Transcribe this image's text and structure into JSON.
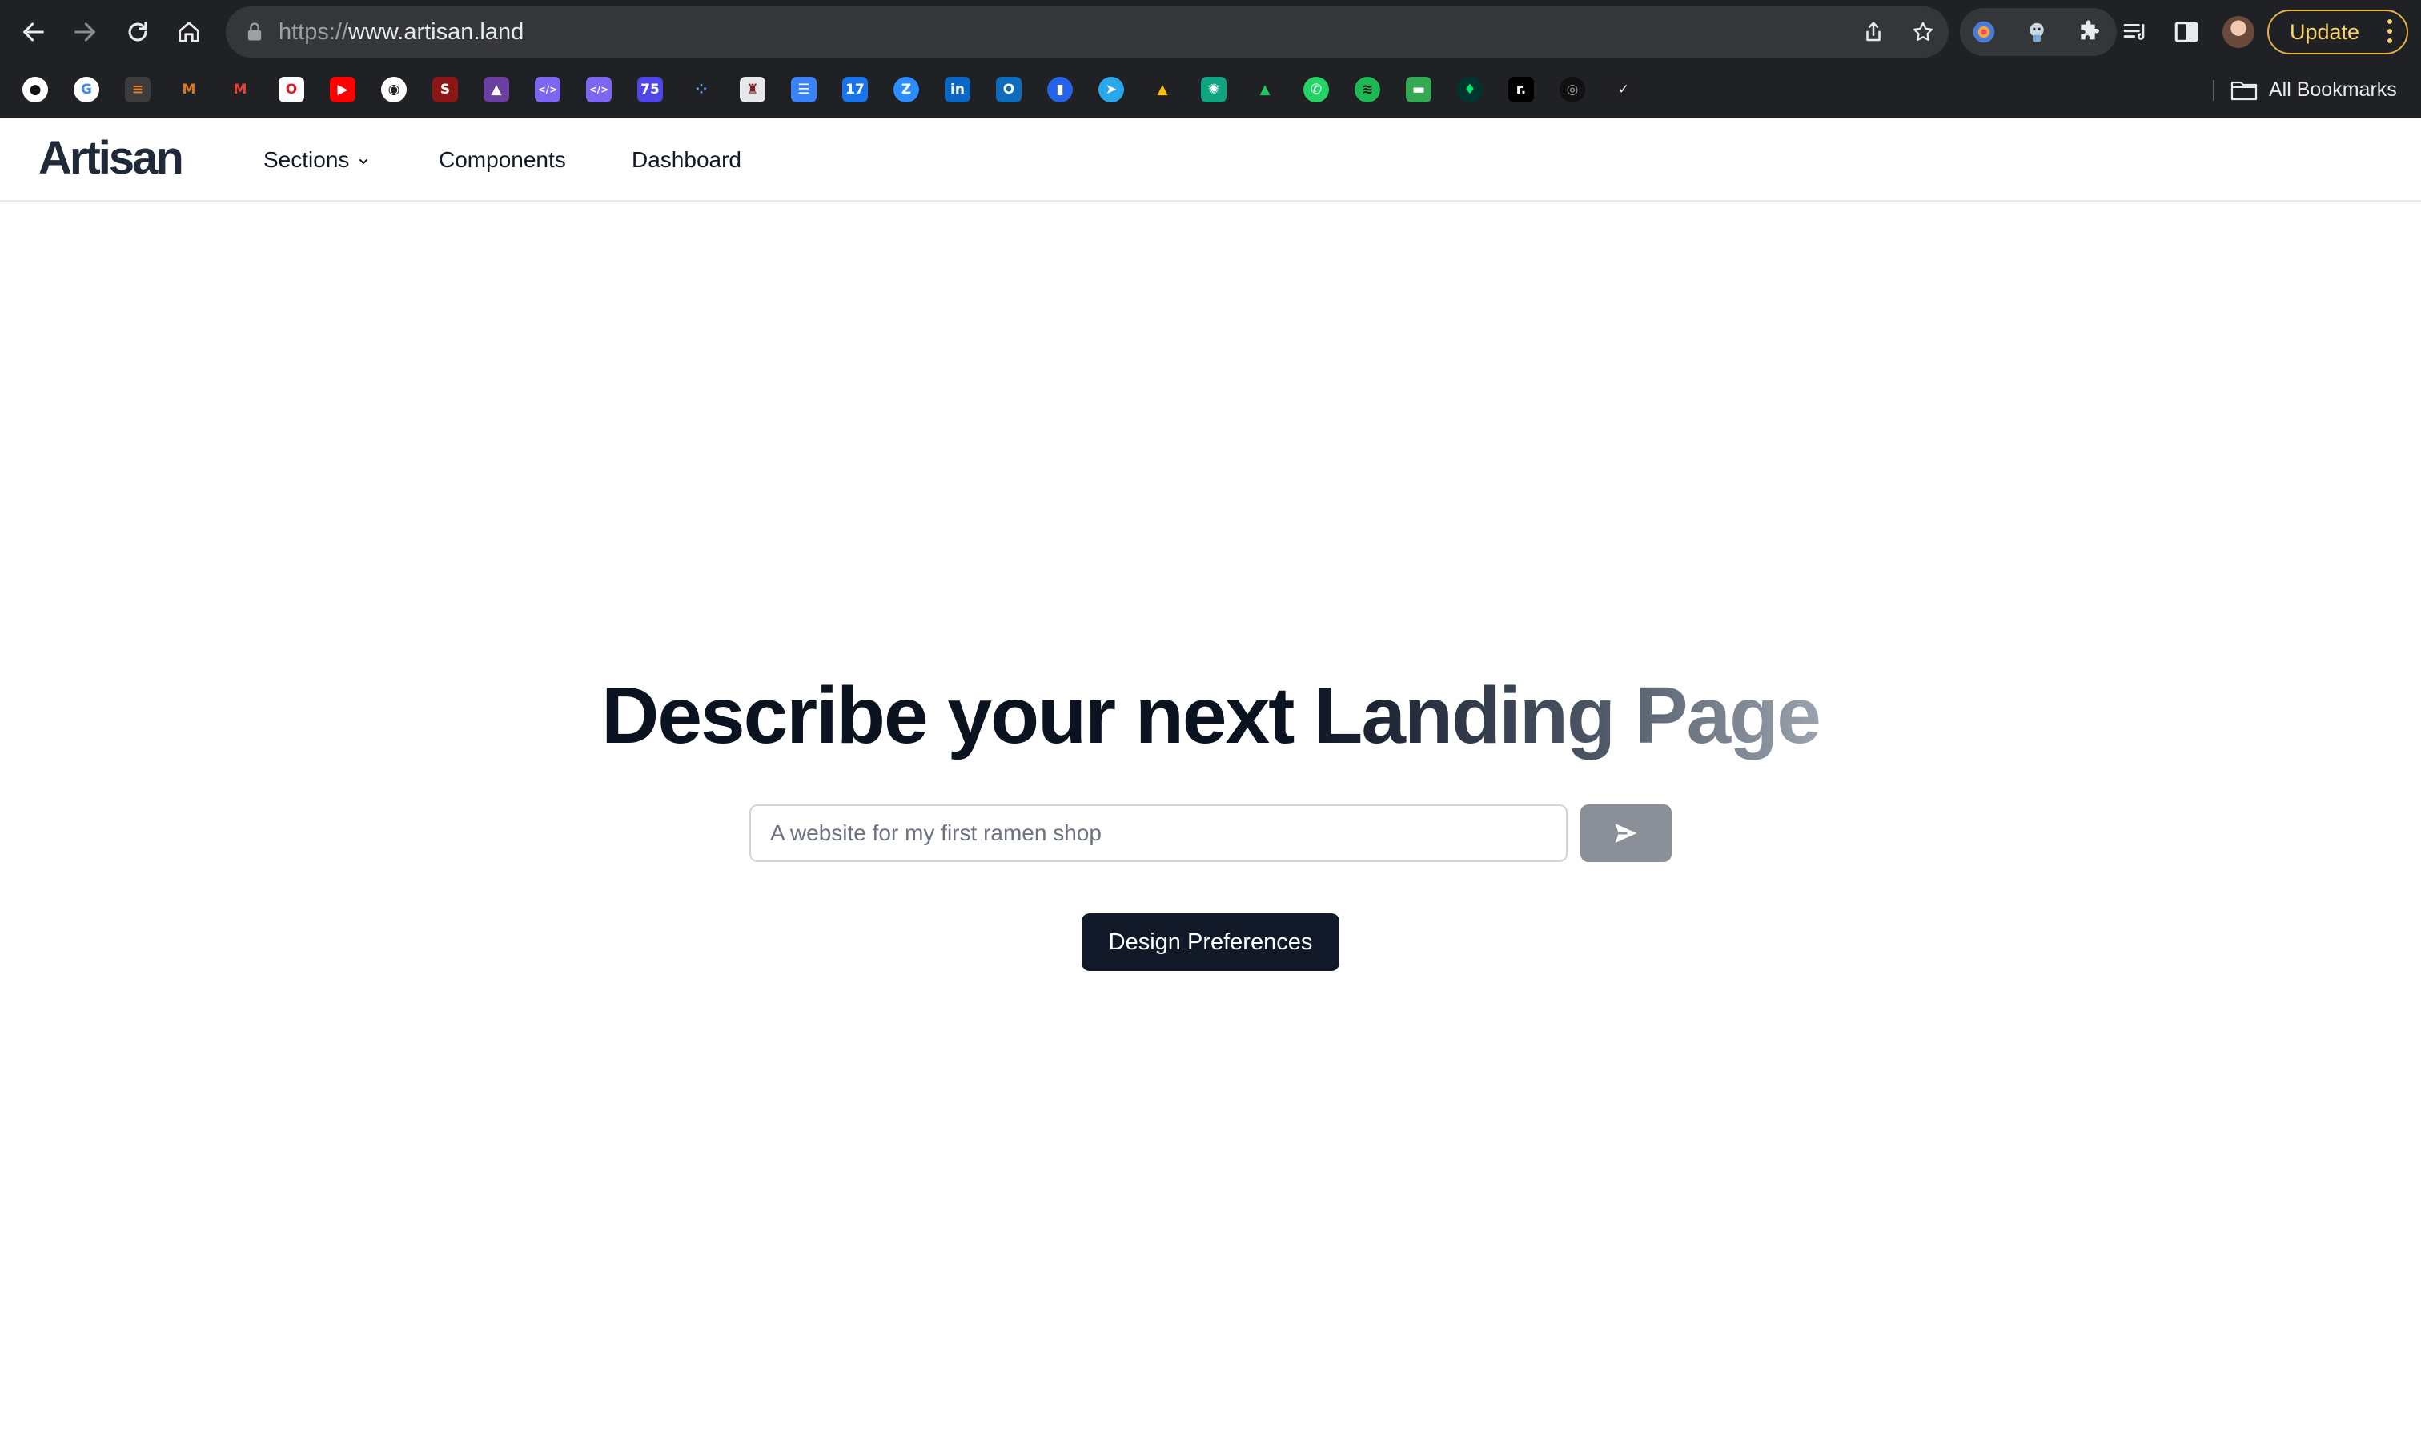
{
  "browser": {
    "url_scheme": "https://",
    "url_host": "www.artisan.land",
    "update_label": "Update",
    "all_bookmarks_label": "All Bookmarks",
    "icons": {
      "back": "arrow-left",
      "forward": "arrow-right",
      "reload": "reload",
      "home": "home",
      "lock": "lock",
      "share": "share",
      "bookmark_star": "star",
      "extensions": "puzzle",
      "reading_list": "reading-list",
      "side_panel": "side-panel",
      "menu": "kebab"
    },
    "bookmarks": [
      {
        "name": "github",
        "color": "#ffffff",
        "glyph": "●",
        "text_color": "#111111",
        "round": true
      },
      {
        "name": "google",
        "color": "#ffffff",
        "glyph": "G",
        "text_color": "#4285f4",
        "round": true
      },
      {
        "name": "stack",
        "color": "#3c3c3c",
        "glyph": "≡",
        "text_color": "#f48024",
        "round": false
      },
      {
        "name": "metamask",
        "color": "#202124",
        "glyph": "M",
        "text_color": "#e2761b",
        "round": false
      },
      {
        "name": "gmail",
        "color": "#202124",
        "glyph": "M",
        "text_color": "#ea4335",
        "round": false
      },
      {
        "name": "opera",
        "color": "#ffffff",
        "glyph": "O",
        "text_color": "#e11d2b",
        "round": false
      },
      {
        "name": "youtube",
        "color": "#ff0000",
        "glyph": "▶",
        "text_color": "#ffffff",
        "round": false
      },
      {
        "name": "globe",
        "color": "#ffffff",
        "glyph": "◉",
        "text_color": "#202124",
        "round": true
      },
      {
        "name": "stanford",
        "color": "#8c1515",
        "glyph": "S",
        "text_color": "#ffffff",
        "round": false
      },
      {
        "name": "cap",
        "color": "#6b3fa0",
        "glyph": "▲",
        "text_color": "#ffffff",
        "round": false
      },
      {
        "name": "code-1",
        "color": "#7b68ee",
        "glyph": "</>",
        "text_color": "#ffffff",
        "round": false
      },
      {
        "name": "code-2",
        "color": "#7b68ee",
        "glyph": "</>",
        "text_color": "#ffffff",
        "round": false
      },
      {
        "name": "seventy-five",
        "color": "#4f46e5",
        "glyph": "75",
        "text_color": "#ffffff",
        "round": false
      },
      {
        "name": "dots",
        "color": "#202124",
        "glyph": "⁘",
        "text_color": "#60a5fa",
        "round": false
      },
      {
        "name": "crest",
        "color": "#e5e7eb",
        "glyph": "♜",
        "text_color": "#7f1d1d",
        "round": false
      },
      {
        "name": "cloud",
        "color": "#3b82f6",
        "glyph": "☰",
        "text_color": "#ffffff",
        "round": false
      },
      {
        "name": "calendar",
        "color": "#1a73e8",
        "glyph": "17",
        "text_color": "#ffffff",
        "round": false
      },
      {
        "name": "zoom",
        "color": "#2d8cff",
        "glyph": "Z",
        "text_color": "#ffffff",
        "round": true
      },
      {
        "name": "linkedin",
        "color": "#0a66c2",
        "glyph": "in",
        "text_color": "#ffffff",
        "round": false
      },
      {
        "name": "outlook",
        "color": "#0f6cbd",
        "glyph": "O",
        "text_color": "#ffffff",
        "round": false
      },
      {
        "name": "analytics",
        "color": "#2563eb",
        "glyph": "▮",
        "text_color": "#ffffff",
        "round": true
      },
      {
        "name": "telegram",
        "color": "#29a9eb",
        "glyph": "➤",
        "text_color": "#ffffff",
        "round": true
      },
      {
        "name": "drive",
        "color": "#202124",
        "glyph": "▲",
        "text_color": "#fbbc04",
        "round": false
      },
      {
        "name": "chatgpt",
        "color": "#10a37f",
        "glyph": "✺",
        "text_color": "#ffffff",
        "round": false
      },
      {
        "name": "classroom",
        "color": "#202124",
        "glyph": "▲",
        "text_color": "#22c55e",
        "round": false
      },
      {
        "name": "whatsapp",
        "color": "#25d366",
        "glyph": "✆",
        "text_color": "#ffffff",
        "round": true
      },
      {
        "name": "spotify",
        "color": "#1db954",
        "glyph": "≋",
        "text_color": "#111111",
        "round": true
      },
      {
        "name": "chat",
        "color": "#34a853",
        "glyph": "▬",
        "text_color": "#ffffff",
        "round": false
      },
      {
        "name": "mongodb",
        "color": "#023430",
        "glyph": "♦",
        "text_color": "#00ed64",
        "round": true
      },
      {
        "name": "notion-r",
        "color": "#000000",
        "glyph": "r.",
        "text_color": "#ffffff",
        "round": false
      },
      {
        "name": "dark-circle",
        "color": "#111111",
        "glyph": "◎",
        "text_color": "#9ca3af",
        "round": true
      },
      {
        "name": "check-circle",
        "color": "#202124",
        "glyph": "✓",
        "text_color": "#e8eaed",
        "round": true
      }
    ]
  },
  "site": {
    "logo": "Artisan",
    "nav": {
      "sections": "Sections",
      "components": "Components",
      "dashboard": "Dashboard"
    },
    "hero": {
      "title_part1": "Describe your next ",
      "title_part2": "Landing Page",
      "input_placeholder": "A website for my first ramen shop",
      "input_value": "",
      "prefs_button": "Design Preferences"
    }
  },
  "colors": {
    "chrome_bg": "#202124",
    "primary_button": "#111827",
    "send_button": "#8b8f97",
    "update_accent": "#e3b341"
  }
}
